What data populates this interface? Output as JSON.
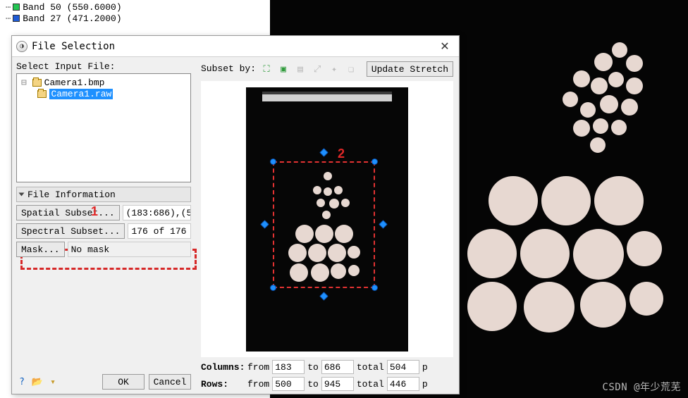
{
  "bands": [
    {
      "color": "#23c552",
      "label": "Band 50 (550.6000)"
    },
    {
      "color": "#1e5bd6",
      "label": "Band 27 (471.2000)"
    }
  ],
  "dialog": {
    "title": "File Selection",
    "select_file_label": "Select Input File:",
    "files": {
      "f1": "Camera1.bmp",
      "f2": "Camera1.raw"
    },
    "file_info_header": "File Information",
    "spatial": {
      "btn": "Spatial Subset...",
      "val": "(183:686),(5"
    },
    "spectral": {
      "btn": "Spectral Subset...",
      "val": "176 of 176"
    },
    "mask": {
      "btn": "Mask...",
      "val": "No mask"
    },
    "ok": "OK",
    "cancel": "Cancel"
  },
  "subset": {
    "label": "Subset by:",
    "update_btn": "Update Stretch",
    "annot": "2",
    "columns": {
      "label": "Columns:",
      "from_lbl": "from",
      "from": "183",
      "to_lbl": "to",
      "to": "686",
      "total_lbl": "total",
      "total": "504",
      "unit": "p"
    },
    "rows": {
      "label": "Rows:",
      "from_lbl": "from",
      "from": "500",
      "to_lbl": "to",
      "to": "945",
      "total_lbl": "total",
      "total": "446",
      "unit": "p"
    }
  },
  "annot1": "1",
  "watermark": "CSDN @年少荒芜"
}
